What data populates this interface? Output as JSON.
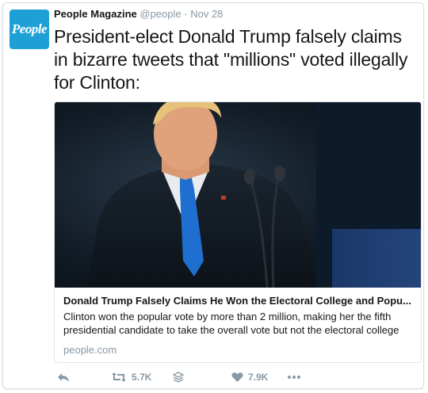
{
  "tweet": {
    "avatar_text": "People",
    "author_name": "People Magazine",
    "handle": "@people",
    "separator": "·",
    "time": "Nov 28",
    "text": "President-elect Donald Trump falsely claims in bizarre tweets that \"millions\" voted illegally for Clinton:"
  },
  "card": {
    "title": "Donald Trump Falsely Claims He Won the Electoral College and Popu...",
    "description": "Clinton won the popular vote by more than 2 million, making her the fifth presidential candidate to take the overall vote but not the electoral college",
    "domain": "people.com"
  },
  "actions": {
    "reply_icon": "reply-icon",
    "retweet_icon": "retweet-icon",
    "retweet_count": "5.7K",
    "stack_icon": "stack-icon",
    "like_icon": "heart-icon",
    "like_count": "7.9K",
    "more_icon": "more-icon"
  },
  "colors": {
    "brand": "#1da0d6",
    "icon_gray": "#8899a6",
    "text": "#14171a",
    "tie_blue": "#1f6fd0"
  }
}
